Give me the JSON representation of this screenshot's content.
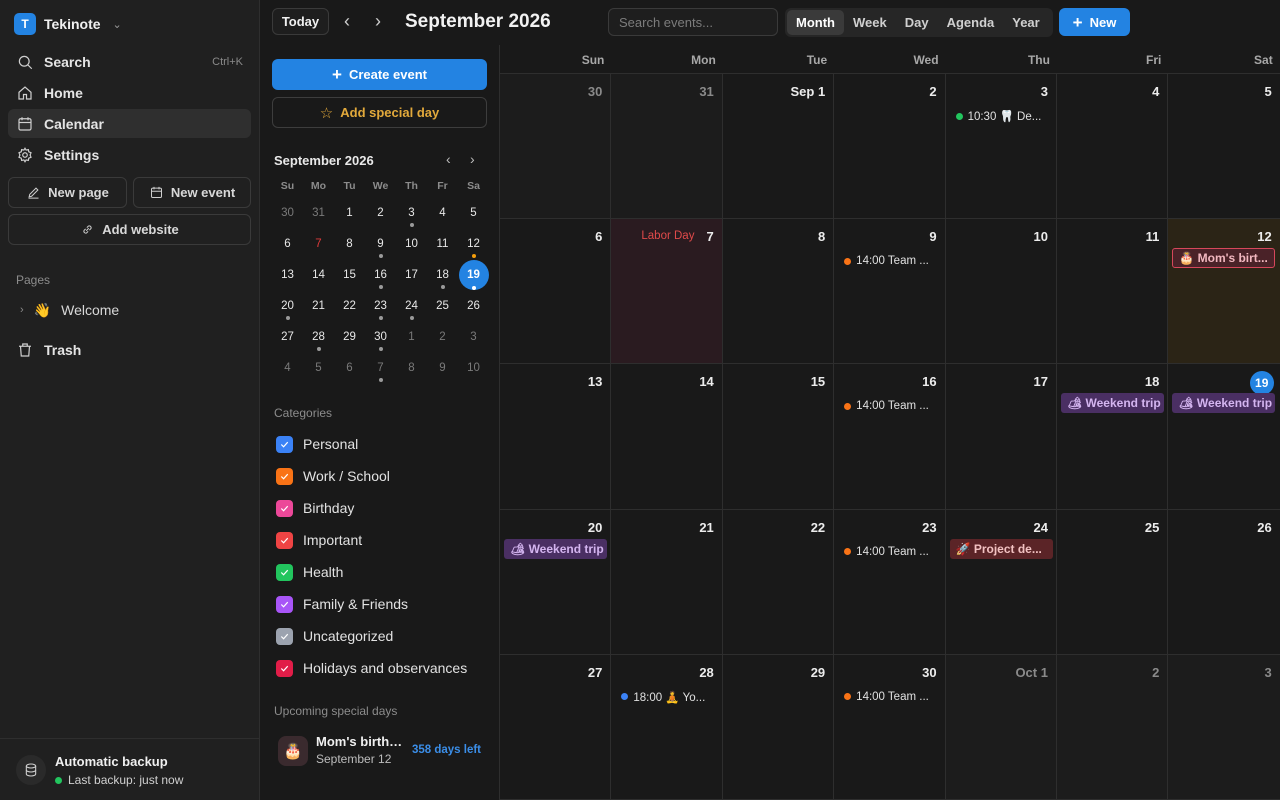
{
  "workspace": {
    "logo_letter": "T",
    "name": "Tekinote"
  },
  "sidebar": {
    "nav": [
      {
        "label": "Search",
        "shortcut": "Ctrl+K"
      },
      {
        "label": "Home"
      },
      {
        "label": "Calendar",
        "active": true
      },
      {
        "label": "Settings"
      }
    ],
    "new_page_label": "New page",
    "new_event_label": "New event",
    "add_website_label": "Add website",
    "pages_heading": "Pages",
    "pages": [
      {
        "icon": "👋",
        "label": "Welcome"
      }
    ],
    "trash_label": "Trash",
    "backup": {
      "title": "Automatic backup",
      "status": "Last backup: just now"
    }
  },
  "topbar": {
    "today_label": "Today",
    "month_title": "September 2026",
    "search_placeholder": "Search events...",
    "views": [
      "Month",
      "Week",
      "Day",
      "Agenda",
      "Year"
    ],
    "active_view": "Month",
    "new_label": "New"
  },
  "panel": {
    "create_event_label": "Create event",
    "add_special_day_label": "Add special day",
    "mini_calendar": {
      "title": "September 2026",
      "weekdays": [
        "Su",
        "Mo",
        "Tu",
        "We",
        "Th",
        "Fr",
        "Sa"
      ],
      "weeks": [
        [
          {
            "d": "30",
            "o": true
          },
          {
            "d": "31",
            "o": true
          },
          {
            "d": "1"
          },
          {
            "d": "2"
          },
          {
            "d": "3",
            "dot": true
          },
          {
            "d": "4"
          },
          {
            "d": "5"
          }
        ],
        [
          {
            "d": "6"
          },
          {
            "d": "7",
            "red": true
          },
          {
            "d": "8"
          },
          {
            "d": "9",
            "dot": true
          },
          {
            "d": "10"
          },
          {
            "d": "11"
          },
          {
            "d": "12",
            "dot": "orange"
          }
        ],
        [
          {
            "d": "13"
          },
          {
            "d": "14"
          },
          {
            "d": "15"
          },
          {
            "d": "16",
            "dot": true
          },
          {
            "d": "17"
          },
          {
            "d": "18",
            "dot": true
          },
          {
            "d": "19",
            "sel": true,
            "dot": true
          }
        ],
        [
          {
            "d": "20",
            "dot": true
          },
          {
            "d": "21"
          },
          {
            "d": "22"
          },
          {
            "d": "23",
            "dot": true
          },
          {
            "d": "24",
            "dot": true
          },
          {
            "d": "25"
          },
          {
            "d": "26"
          }
        ],
        [
          {
            "d": "27"
          },
          {
            "d": "28",
            "dot": true
          },
          {
            "d": "29"
          },
          {
            "d": "30",
            "dot": true
          },
          {
            "d": "1",
            "o": true
          },
          {
            "d": "2",
            "o": true
          },
          {
            "d": "3",
            "o": true
          }
        ],
        [
          {
            "d": "4",
            "o": true
          },
          {
            "d": "5",
            "o": true
          },
          {
            "d": "6",
            "o": true
          },
          {
            "d": "7",
            "o": true,
            "dot": true
          },
          {
            "d": "8",
            "o": true
          },
          {
            "d": "9",
            "o": true
          },
          {
            "d": "10",
            "o": true
          }
        ]
      ]
    },
    "categories_heading": "Categories",
    "categories": [
      {
        "label": "Personal",
        "color": "#3b82f6"
      },
      {
        "label": "Work / School",
        "color": "#f97316"
      },
      {
        "label": "Birthday",
        "color": "#ec4899"
      },
      {
        "label": "Important",
        "color": "#ef4444"
      },
      {
        "label": "Health",
        "color": "#22c55e"
      },
      {
        "label": "Family & Friends",
        "color": "#a855f7"
      },
      {
        "label": "Uncategorized",
        "color": "#9ca3af"
      },
      {
        "label": "Holidays and observances",
        "color": "#e11d48"
      }
    ],
    "upcoming_heading": "Upcoming special days",
    "upcoming": {
      "icon": "🎂",
      "title": "Mom's birthday",
      "date": "September 12",
      "days_left": "358 days left"
    }
  },
  "calendar": {
    "weekdays": [
      "Sun",
      "Mon",
      "Tue",
      "Wed",
      "Thu",
      "Fri",
      "Sat"
    ],
    "weeks": [
      [
        {
          "d": "30",
          "o": true
        },
        {
          "d": "31",
          "o": true
        },
        {
          "d": "Sep 1"
        },
        {
          "d": "2"
        },
        {
          "d": "3",
          "events": [
            {
              "type": "dot",
              "color": "#22c55e",
              "text": "10:30 🦷 De..."
            }
          ]
        },
        {
          "d": "4"
        },
        {
          "d": "5"
        }
      ],
      [
        {
          "d": "6"
        },
        {
          "d": "7",
          "holiday": "Labor Day"
        },
        {
          "d": "8"
        },
        {
          "d": "9",
          "events": [
            {
              "type": "dot",
              "color": "#f97316",
              "text": "14:00 Team ..."
            }
          ]
        },
        {
          "d": "10"
        },
        {
          "d": "11"
        },
        {
          "d": "12",
          "special": true,
          "events": [
            {
              "type": "bar",
              "style": "pink",
              "text": "🎂 Mom's birt..."
            }
          ]
        }
      ],
      [
        {
          "d": "13"
        },
        {
          "d": "14"
        },
        {
          "d": "15"
        },
        {
          "d": "16",
          "events": [
            {
              "type": "dot",
              "color": "#f97316",
              "text": "14:00 Team ..."
            }
          ]
        },
        {
          "d": "17"
        },
        {
          "d": "18",
          "events": [
            {
              "type": "bar",
              "style": "purple",
              "text": "🏕 Weekend trip"
            }
          ]
        },
        {
          "d": "19",
          "today": true,
          "events": [
            {
              "type": "bar",
              "style": "purple",
              "text": "🏕 Weekend trip"
            }
          ]
        }
      ],
      [
        {
          "d": "20",
          "events": [
            {
              "type": "bar",
              "style": "purple",
              "text": "🏕 Weekend trip"
            }
          ]
        },
        {
          "d": "21"
        },
        {
          "d": "22"
        },
        {
          "d": "23",
          "events": [
            {
              "type": "dot",
              "color": "#f97316",
              "text": "14:00 Team ..."
            }
          ]
        },
        {
          "d": "24",
          "events": [
            {
              "type": "bar",
              "style": "red",
              "text": "🚀 Project de..."
            }
          ]
        },
        {
          "d": "25"
        },
        {
          "d": "26"
        }
      ],
      [
        {
          "d": "27"
        },
        {
          "d": "28",
          "events": [
            {
              "type": "dot",
              "color": "#3b82f6",
              "text": "18:00 🧘 Yo..."
            }
          ]
        },
        {
          "d": "29"
        },
        {
          "d": "30",
          "events": [
            {
              "type": "dot",
              "color": "#f97316",
              "text": "14:00 Team ..."
            }
          ]
        },
        {
          "d": "Oct 1",
          "o": true
        },
        {
          "d": "2",
          "o": true
        },
        {
          "d": "3",
          "o": true
        }
      ]
    ]
  }
}
